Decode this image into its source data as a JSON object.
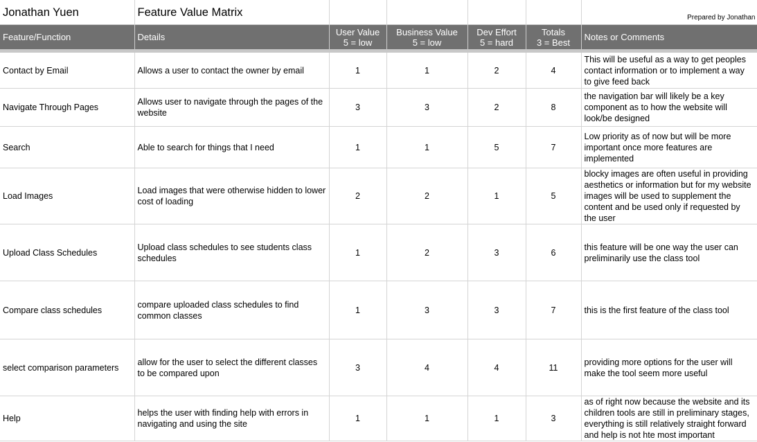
{
  "title_row": {
    "author": "Jonathan Yuen",
    "sheet_title": "Feature Value Matrix",
    "prepared_by": "Prepared by Jonathan"
  },
  "headers": {
    "feature": "Feature/Function",
    "details": "Details",
    "user_value": "User Value",
    "user_value_scale": "5 = low",
    "business_value": "Business Value",
    "business_value_scale": "5 = low",
    "dev_effort": "Dev Effort",
    "dev_effort_scale": "5 = hard",
    "totals": "Totals",
    "totals_scale": "3 = Best",
    "notes": "Notes or Comments"
  },
  "rows": [
    {
      "feature": "Contact by Email",
      "details": "Allows a user to contact the owner by email",
      "user": "1",
      "business": "1",
      "effort": "2",
      "total": "4",
      "notes": "This will be useful as a way to get peoples contact information or to implement a way to give feed back"
    },
    {
      "feature": "Navigate Through Pages",
      "details": "Allows user to navigate through the pages of the website",
      "user": "3",
      "business": "3",
      "effort": "2",
      "total": "8",
      "notes": "the navigation bar will likely be a key component as to how the website will look/be designed"
    },
    {
      "feature": "Search",
      "details": "Able to search for things that I need",
      "user": "1",
      "business": "1",
      "effort": "5",
      "total": "7",
      "notes": "Low priority as of now but will be more important once more features are implemented"
    },
    {
      "feature": "Load Images",
      "details": "Load images that were otherwise hidden to lower cost of loading",
      "user": "2",
      "business": "2",
      "effort": "1",
      "total": "5",
      "notes": "blocky images are often useful in providing aesthetics or information but for my website images will be used to supplement the content and be used only if requested by the user"
    },
    {
      "feature": "Upload Class Schedules",
      "details": "Upload class schedules to see students class schedules",
      "user": "1",
      "business": "2",
      "effort": "3",
      "total": "6",
      "notes": "this feature will be one way the user can preliminarily use the class tool"
    },
    {
      "feature": "Compare class schedules",
      "details": "compare uploaded class schedules to find common classes",
      "user": "1",
      "business": "3",
      "effort": "3",
      "total": "7",
      "notes": "this is the first feature of the class tool"
    },
    {
      "feature": "select comparison parameters",
      "details": "allow for the user to select the different classes to be compared upon",
      "user": "3",
      "business": "4",
      "effort": "4",
      "total": "11",
      "notes": "providing more options for the user will make the tool seem more useful"
    },
    {
      "feature": "Help",
      "details": "helps the user with finding help with errors in navigating and using the site",
      "user": "1",
      "business": "1",
      "effort": "1",
      "total": "3",
      "notes": "as of right now because the website and its children tools are still in preliminary stages, everything is still relatively straight forward and help is not hte most important"
    }
  ]
}
